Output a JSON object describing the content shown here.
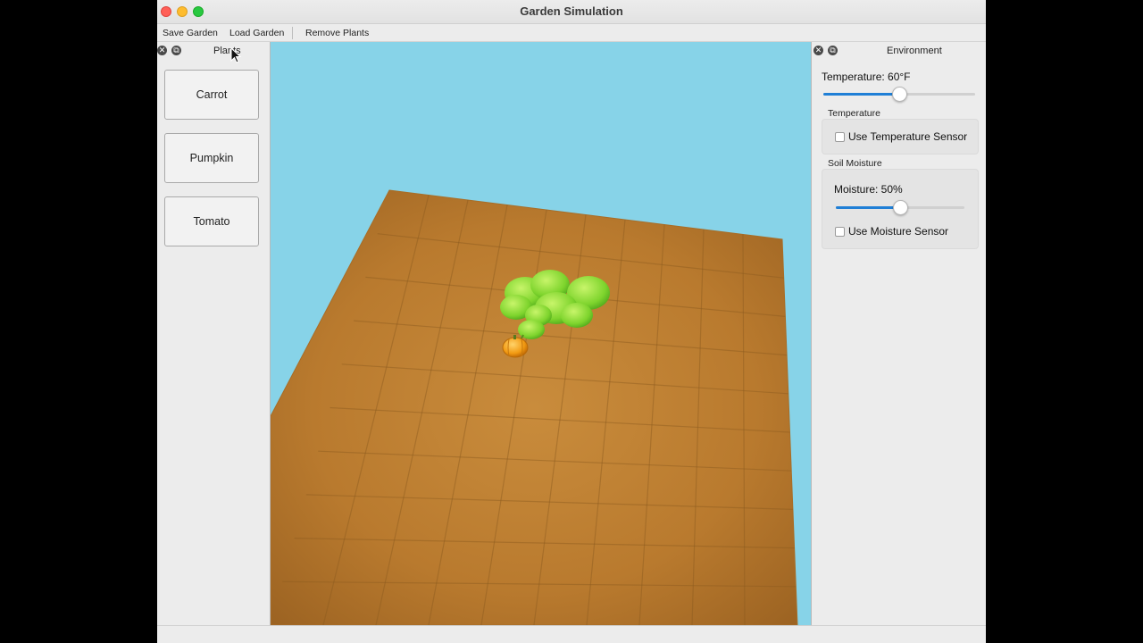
{
  "window": {
    "title": "Garden Simulation"
  },
  "toolbar": {
    "save_label": "Save Garden",
    "load_label": "Load Garden",
    "remove_label": "Remove Plants"
  },
  "plants_panel": {
    "title": "Plants",
    "items": [
      {
        "label": "Carrot"
      },
      {
        "label": "Pumpkin"
      },
      {
        "label": "Tomato"
      }
    ]
  },
  "environment_panel": {
    "title": "Environment",
    "temperature_label": "Temperature: 60°F",
    "temperature_slider_fraction": 0.5,
    "temperature_group_title": "Temperature",
    "use_temperature_sensor_label": "Use Temperature Sensor",
    "use_temperature_sensor_checked": false,
    "soil_moisture_group_title": "Soil Moisture",
    "moisture_label": "Moisture: 50%",
    "moisture_slider_fraction": 0.5,
    "use_moisture_sensor_label": "Use Moisture Sensor",
    "use_moisture_sensor_checked": false
  },
  "scene": {
    "sky_color": "#87d3e8",
    "soil_color": "#c08535",
    "grid_columns": 10,
    "grid_rows": 10
  },
  "icons": {
    "dock_close": "close-icon",
    "dock_float": "float-icon"
  },
  "colors": {
    "accent": "#1f7fd6",
    "close": "#ff5f57",
    "minimize": "#febc2e",
    "maximize": "#28c840"
  }
}
